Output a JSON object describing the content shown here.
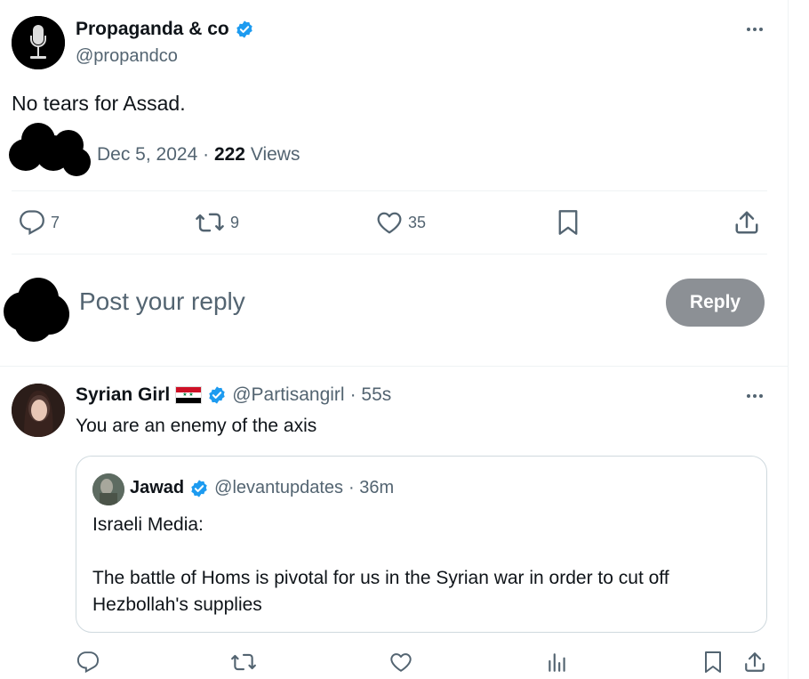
{
  "main_post": {
    "author_name": "Propaganda & co",
    "author_handle": "@propandco",
    "text": "No tears for Assad.",
    "date": "Dec 5, 2024",
    "separator": "·",
    "views_count": "222",
    "views_label": "Views",
    "actions": {
      "replies": "7",
      "reposts": "9",
      "likes": "35"
    }
  },
  "compose": {
    "placeholder": "Post your reply",
    "reply_button": "Reply"
  },
  "reply_post": {
    "author_name": "Syrian Girl",
    "flag": "🇸🇾",
    "author_handle": "@Partisangirl",
    "time": "· 55s",
    "text": "You are an enemy of the axis",
    "quote": {
      "author_name": "Jawad",
      "author_handle": "@levantupdates",
      "time": "· 36m",
      "line1": "Israeli Media:",
      "line2": "The battle of Homs is pivotal for us in the Syrian war in order to cut off Hezbollah's supplies"
    }
  },
  "colors": {
    "verified_blue": "#1d9bf0",
    "secondary_text": "#536471",
    "reply_button_disabled": "#8c9095",
    "divider": "#eff3f4"
  }
}
